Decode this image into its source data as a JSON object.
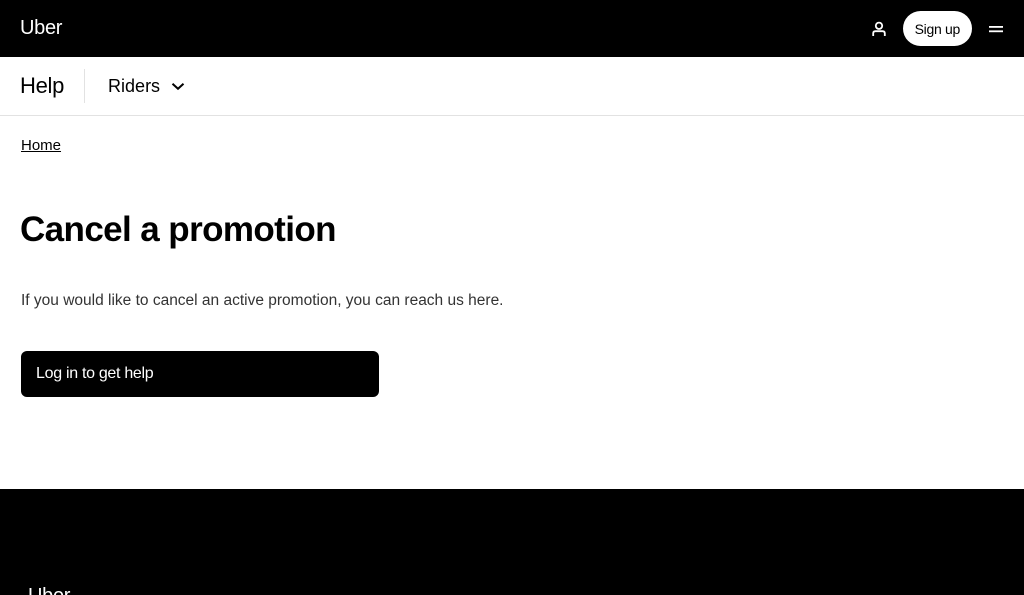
{
  "header": {
    "logo": "Uber",
    "signup_label": "Sign up",
    "user_icon": "user-icon",
    "menu_icon": "menu-icon"
  },
  "subnav": {
    "title": "Help",
    "dropdown_label": "Riders",
    "dropdown_icon": "chevron-down-icon"
  },
  "main": {
    "breadcrumb": "Home",
    "title": "Cancel a promotion",
    "description": "If you would like to cancel an active promotion, you can reach us here.",
    "cta_label": "Log in to get help"
  },
  "footer": {
    "logo": "Uber"
  },
  "colors": {
    "background": "#ffffff",
    "nav_background": "#000000",
    "footer_background": "#000000",
    "divider": "#e2e2e2"
  }
}
